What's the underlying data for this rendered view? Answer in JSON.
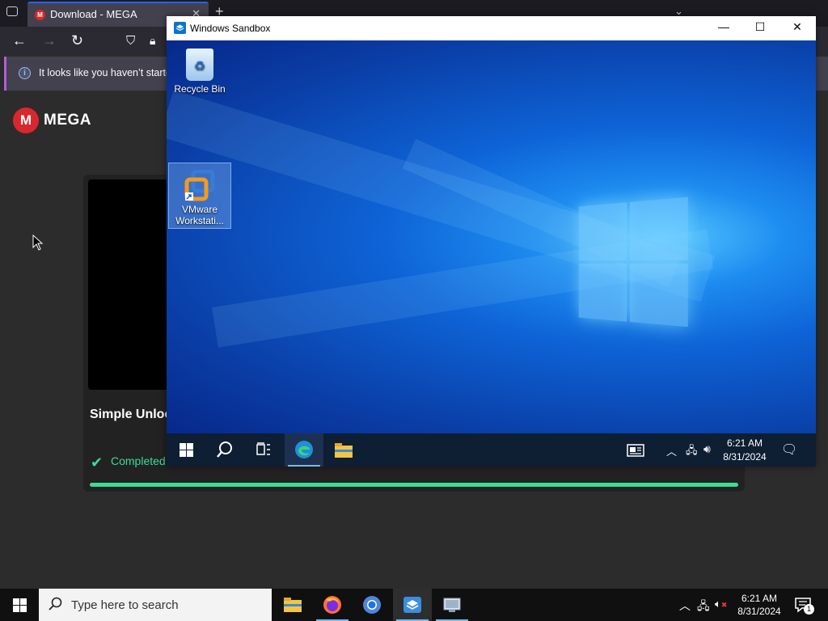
{
  "browser": {
    "tab_title": "Download - MEGA",
    "tab_close": "✕",
    "new_tab": "+",
    "notification": "It looks like you haven’t started"
  },
  "mega": {
    "logo_letter": "M",
    "brand": "MEGA",
    "file_title": "Simple Unloc",
    "status": "Completed",
    "progress": 1.0
  },
  "sandbox": {
    "title": "Windows Sandbox",
    "desktop_icons": [
      {
        "label": "Recycle Bin"
      },
      {
        "label": "VMware Workstati..."
      }
    ],
    "taskbar": {
      "time": "6:21 AM",
      "date": "8/31/2024"
    }
  },
  "host_taskbar": {
    "search_placeholder": "Type here to search",
    "time": "6:21 AM",
    "date": "8/31/2024",
    "notification_count": "1"
  },
  "colors": {
    "accent_green": "#3ddc97",
    "mega_red": "#d9272e",
    "firefox_tab_accent": "#2563eb"
  }
}
